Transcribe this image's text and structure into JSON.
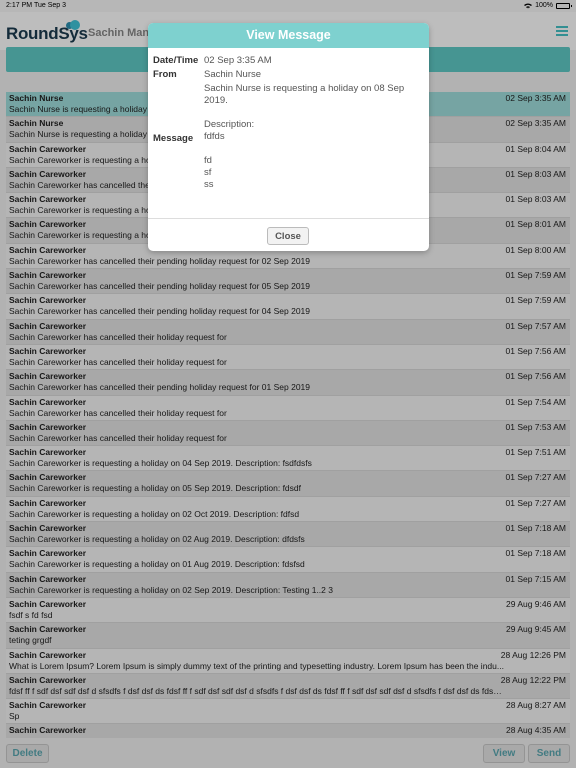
{
  "status_bar": {
    "time": "2:17 PM",
    "date": "Tue Sep 3",
    "battery": "100%"
  },
  "header": {
    "logo": "RoundSys",
    "user_title": "Sachin Manag"
  },
  "messages": [
    {
      "from": "Sachin Nurse",
      "text": "Sachin Nurse is requesting a holiday on 08 Sep 2019.",
      "datetime": "02 Sep 3:35 AM",
      "selected": true
    },
    {
      "from": "Sachin Nurse",
      "text": "Sachin Nurse is requesting a holiday on 08 Sep 2019.",
      "datetime": "02 Sep 3:35 AM"
    },
    {
      "from": "Sachin Careworker",
      "text": "Sachin Careworker is requesting a holiday on 08 Sep 2019.",
      "datetime": "01 Sep 8:04 AM"
    },
    {
      "from": "Sachin Careworker",
      "text": "Sachin Careworker has cancelled their holiday request for 08 Sep 2019",
      "datetime": "01 Sep 8:03 AM"
    },
    {
      "from": "Sachin Careworker",
      "text": "Sachin Careworker is requesting a holiday on 08 Sep 2019.",
      "datetime": "01 Sep 8:03 AM"
    },
    {
      "from": "Sachin Careworker",
      "text": "Sachin Careworker is requesting a holiday on 08 Sep 2019.",
      "datetime": "01 Sep 8:01 AM"
    },
    {
      "from": "Sachin Careworker",
      "text": "Sachin Careworker has cancelled their pending holiday request for 02 Sep 2019",
      "datetime": "01 Sep 8:00 AM"
    },
    {
      "from": "Sachin Careworker",
      "text": "Sachin Careworker has cancelled their pending holiday request for 05 Sep 2019",
      "datetime": "01 Sep 7:59 AM"
    },
    {
      "from": "Sachin Careworker",
      "text": "Sachin Careworker has cancelled their pending holiday request for 04 Sep 2019",
      "datetime": "01 Sep 7:59 AM"
    },
    {
      "from": "Sachin Careworker",
      "text": "Sachin Careworker has cancelled their holiday request for",
      "datetime": "01 Sep 7:57 AM"
    },
    {
      "from": "Sachin Careworker",
      "text": "Sachin Careworker has cancelled their holiday request for",
      "datetime": "01 Sep 7:56 AM"
    },
    {
      "from": "Sachin Careworker",
      "text": "Sachin Careworker has cancelled their pending holiday request for 01 Sep 2019",
      "datetime": "01 Sep 7:56 AM"
    },
    {
      "from": "Sachin Careworker",
      "text": "Sachin Careworker has cancelled their holiday request for",
      "datetime": "01 Sep 7:54 AM"
    },
    {
      "from": "Sachin Careworker",
      "text": "Sachin Careworker has cancelled their holiday request for",
      "datetime": "01 Sep 7:53 AM"
    },
    {
      "from": "Sachin Careworker",
      "text": "Sachin Careworker is requesting a holiday on 04 Sep 2019. Description: fsdfdsfs",
      "datetime": "01 Sep 7:51 AM"
    },
    {
      "from": "Sachin Careworker",
      "text": "Sachin Careworker is requesting a holiday on 05 Sep 2019. Description: fdsdf",
      "datetime": "01 Sep 7:27 AM"
    },
    {
      "from": "Sachin Careworker",
      "text": "Sachin Careworker is requesting a holiday on 02 Oct 2019. Description: fdfsd",
      "datetime": "01 Sep 7:27 AM"
    },
    {
      "from": "Sachin Careworker",
      "text": "Sachin Careworker is requesting a holiday on 02 Aug 2019. Description: dfdsfs",
      "datetime": "01 Sep 7:18 AM"
    },
    {
      "from": "Sachin Careworker",
      "text": "Sachin Careworker is requesting a holiday on 01 Aug 2019. Description: fdsfsd",
      "datetime": "01 Sep 7:18 AM"
    },
    {
      "from": "Sachin Careworker",
      "text": "Sachin Careworker is requesting a holiday on 02 Sep 2019. Description: Testing 1..2 3",
      "datetime": "01 Sep 7:15 AM"
    },
    {
      "from": "Sachin Careworker",
      "text": "fsdf s fd fsd",
      "datetime": "29 Aug 9:46 AM"
    },
    {
      "from": "Sachin Careworker",
      "text": "teting grgdf",
      "datetime": "29 Aug 9:45 AM"
    },
    {
      "from": "Sachin Careworker",
      "text": "What is Lorem Ipsum? Lorem Ipsum is simply dummy text of the printing and typesetting industry. Lorem Ipsum has been the indu...",
      "datetime": "28 Aug 12:26 PM"
    },
    {
      "from": "Sachin Careworker",
      "text": "fdsf ff f sdf dsf sdf dsf d sfsdfs f dsf dsf ds fdsf ff f sdf dsf sdf dsf d sfsdfs f dsf dsf ds fdsf ff f sdf dsf sdf dsf d sfsdfs f dsf dsf ds fdsf ...",
      "datetime": "28 Aug 12:22 PM"
    },
    {
      "from": "Sachin Careworker",
      "text": "Sp",
      "datetime": "28 Aug 8:27 AM"
    },
    {
      "from": "Sachin Careworker",
      "text": "",
      "datetime": "28 Aug 4:35 AM"
    }
  ],
  "footer": {
    "delete_label": "Delete",
    "view_label": "View",
    "send_label": "Send"
  },
  "modal": {
    "title": "View Message",
    "datetime_label": "Date/Time",
    "datetime_value": "02 Sep 3:35 AM",
    "from_label": "From",
    "from_value": "Sachin Nurse",
    "message_label": "Message",
    "message_value": "Sachin Nurse is requesting a holiday on 08 Sep 2019.\n\nDescription:\nfdfds\n\nfd\nsf\nss",
    "close_label": "Close"
  },
  "colors": {
    "accent": "#5fc9c6",
    "header_modal": "#7ed1cf",
    "button_text": "#5aa7b0"
  }
}
